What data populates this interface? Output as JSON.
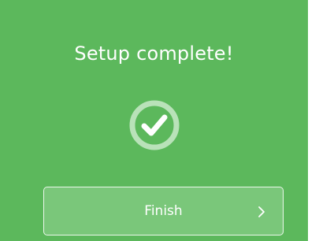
{
  "setup": {
    "title": "Setup complete!",
    "status_icon": "check-circle-icon",
    "finish_label": "Finish",
    "finish_icon": "chevron-right-icon"
  },
  "colors": {
    "background": "#5cb85c",
    "button": "#7ac77a",
    "text": "#ffffff"
  }
}
